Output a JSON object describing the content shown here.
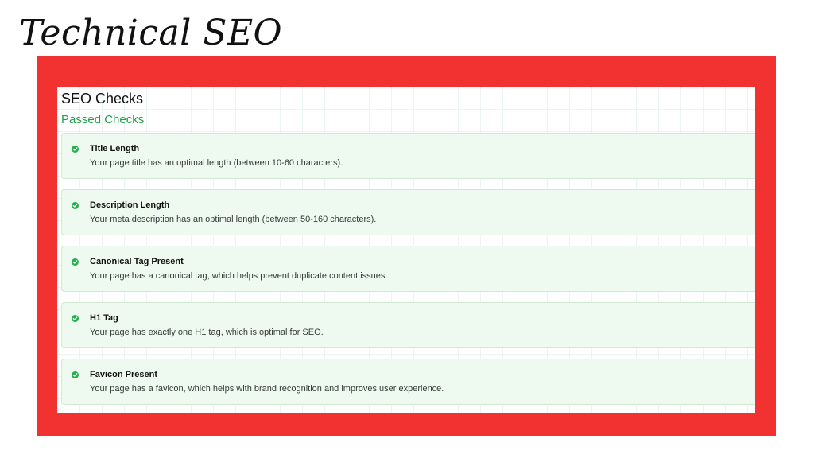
{
  "slide": {
    "title": "Technical SEO"
  },
  "panel": {
    "heading": "SEO Checks",
    "section_heading": "Passed Checks",
    "checks": [
      {
        "title": "Title Length",
        "description": "Your page title has an optimal length (between 10-60 characters).",
        "status_icon": "check-circle-icon"
      },
      {
        "title": "Description Length",
        "description": "Your meta description has an optimal length (between 50-160 characters).",
        "status_icon": "check-circle-icon"
      },
      {
        "title": "Canonical Tag Present",
        "description": "Your page has a canonical tag, which helps prevent duplicate content issues.",
        "status_icon": "check-circle-icon"
      },
      {
        "title": "H1 Tag",
        "description": "Your page has exactly one H1 tag, which is optimal for SEO.",
        "status_icon": "check-circle-icon"
      },
      {
        "title": "Favicon Present",
        "description": "Your page has a favicon, which helps with brand recognition and improves user experience.",
        "status_icon": "check-circle-icon"
      }
    ]
  },
  "colors": {
    "frame": "#f23131",
    "passed_text": "#1e9e49",
    "check_icon": "#22b14c",
    "card_background": "#eefaef",
    "card_border": "#cfe9d3"
  }
}
